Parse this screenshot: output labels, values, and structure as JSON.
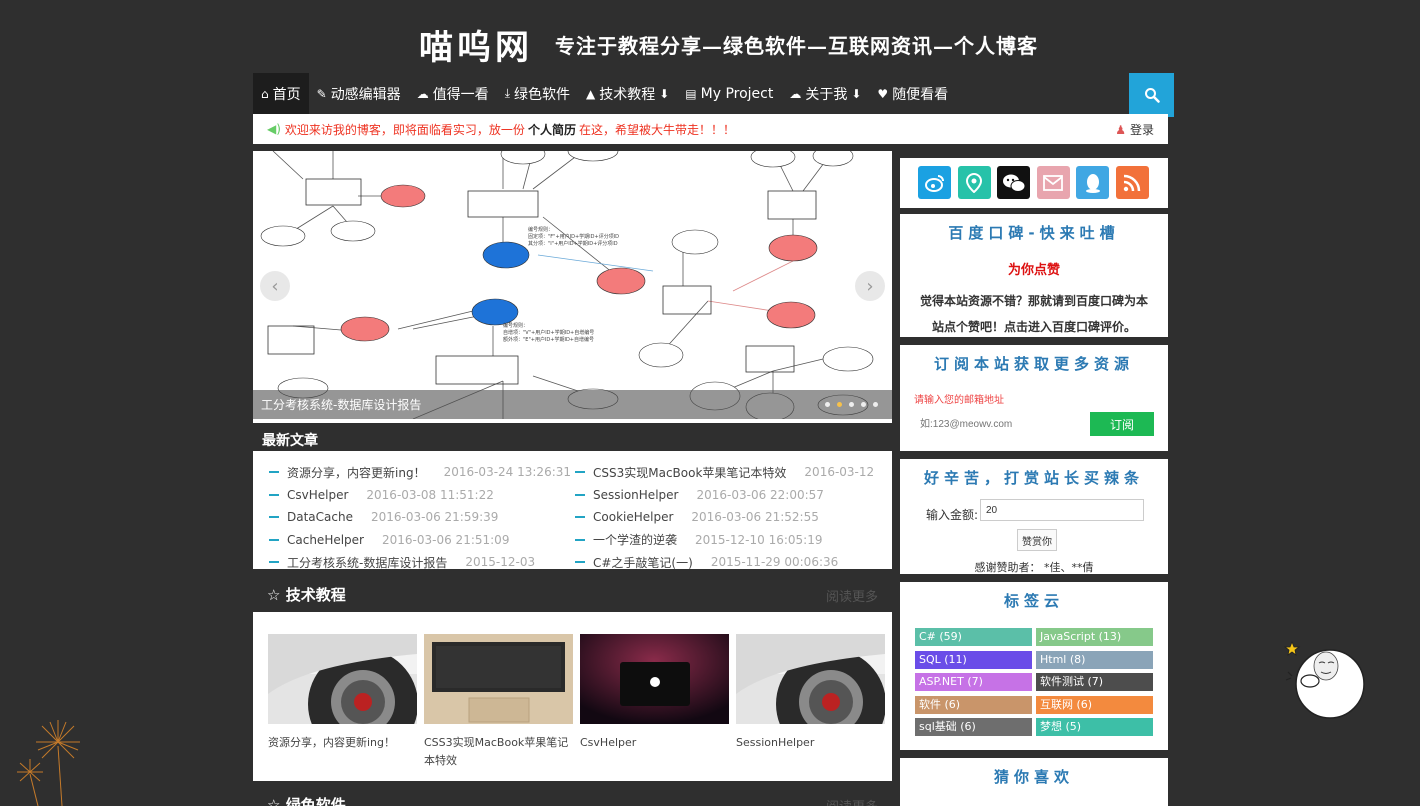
{
  "header": {
    "logo": "喵呜网",
    "slogan": "专注于教程分享—绿色软件—互联网资讯—个人博客"
  },
  "nav": [
    {
      "icon": "home-icon",
      "glyph": "⌂",
      "label": "首页",
      "arrow": false
    },
    {
      "icon": "edit-icon",
      "glyph": "✎",
      "label": "动感编辑器",
      "arrow": false
    },
    {
      "icon": "comments-icon",
      "glyph": "☁",
      "label": "值得一看",
      "arrow": false
    },
    {
      "icon": "download-icon",
      "glyph": "⤓",
      "label": "绿色软件",
      "arrow": false
    },
    {
      "icon": "graduation-cap-icon",
      "glyph": "▲",
      "label": "技术教程",
      "arrow": true
    },
    {
      "icon": "file-icon",
      "glyph": "▤",
      "label": "My Project",
      "arrow": false
    },
    {
      "icon": "comment-icon",
      "glyph": "☁",
      "label": "关于我",
      "arrow": true
    },
    {
      "icon": "heart-icon",
      "glyph": "♥",
      "label": "随便看看",
      "arrow": false
    }
  ],
  "search": {
    "icon": "search-icon"
  },
  "notice": {
    "text": "欢迎来访我的博客，即将面临看实习，放一份",
    "link": "个人简历",
    "tail": "在这，希望被大牛带走！！！",
    "login": "登录"
  },
  "slider": {
    "caption": "工分考核系统-数据库设计报告",
    "dots": 5,
    "active_dot": 1
  },
  "latest": {
    "title": "最新文章",
    "left": [
      {
        "title": "资源分享，内容更新ing！",
        "date": "2016-03-24 13:26:31"
      },
      {
        "title": "CsvHelper",
        "date": "2016-03-08 11:51:22"
      },
      {
        "title": "DataCache",
        "date": "2016-03-06 21:59:39"
      },
      {
        "title": "CacheHelper",
        "date": "2016-03-06 21:51:09"
      },
      {
        "title": "工分考核系统-数据库设计报告",
        "date": "2015-12-03"
      }
    ],
    "right": [
      {
        "title": "CSS3实现MacBook苹果笔记本特效",
        "date": "2016-03-12"
      },
      {
        "title": "SessionHelper",
        "date": "2016-03-06 22:00:57"
      },
      {
        "title": "CookieHelper",
        "date": "2016-03-06 21:52:55"
      },
      {
        "title": "一个学渣的逆袭",
        "date": "2015-12-10 16:05:19"
      },
      {
        "title": "C#之手敲笔记(一)",
        "date": "2015-11-29 00:06:36"
      }
    ]
  },
  "tech": {
    "title": "技术教程",
    "more": "阅读更多",
    "cards": [
      {
        "caption": "资源分享，内容更新ing！",
        "thumb": "car-wheel"
      },
      {
        "caption": "CSS3实现MacBook苹果笔记本特效",
        "thumb": "keyboard"
      },
      {
        "caption": "CsvHelper",
        "thumb": "macbook"
      },
      {
        "caption": "SessionHelper",
        "thumb": "car-wheel"
      }
    ]
  },
  "software": {
    "title": "绿色软件",
    "more": "阅读更多"
  },
  "social": [
    {
      "icon": "weibo-icon",
      "color": "#1ba1e2"
    },
    {
      "icon": "periscope-icon",
      "color": "#27c2a9"
    },
    {
      "icon": "wechat-icon",
      "color": "#111111"
    },
    {
      "icon": "mail-icon",
      "color": "#e8a5ae"
    },
    {
      "icon": "qq-icon",
      "color": "#40a7e3"
    },
    {
      "icon": "rss-icon",
      "color": "#f2713a"
    }
  ],
  "koubei": {
    "title": "百度口碑-快来吐槽",
    "subtitle": "为你点赞",
    "desc": "觉得本站资源不错？那就请到百度口碑为本站点个赞吧！点击进入百度口碑评价。"
  },
  "subscribe": {
    "title": "订阅本站获取更多资源",
    "hint": "请输入您的邮箱地址",
    "placeholder": "如:123@meowv.com",
    "button": "订阅"
  },
  "donate": {
    "title": "好辛苦，打赏站长买辣条",
    "label": "输入金额:",
    "value": "20",
    "button": "赞赏你",
    "thanks": "感谢赞助者：  *佳、**倩"
  },
  "tags": {
    "title": "标签云",
    "items": [
      {
        "label": "C# (59)",
        "color": "#5bbfa8"
      },
      {
        "label": "JavaScript (13)",
        "color": "#86c98a"
      },
      {
        "label": "SQL (11)",
        "color": "#6a4de8"
      },
      {
        "label": "Html (8)",
        "color": "#8aa4b8"
      },
      {
        "label": "ASP.NET (7)",
        "color": "#c672e6"
      },
      {
        "label": "软件测试 (7)",
        "color": "#4d4d4d"
      },
      {
        "label": "软件 (6)",
        "color": "#c9956a"
      },
      {
        "label": "互联网 (6)",
        "color": "#f38a3e"
      },
      {
        "label": "sql基础 (6)",
        "color": "#6e6e6e"
      },
      {
        "label": "梦想 (5)",
        "color": "#3dbfa7"
      }
    ]
  },
  "guess": {
    "title": "猜你喜欢"
  }
}
